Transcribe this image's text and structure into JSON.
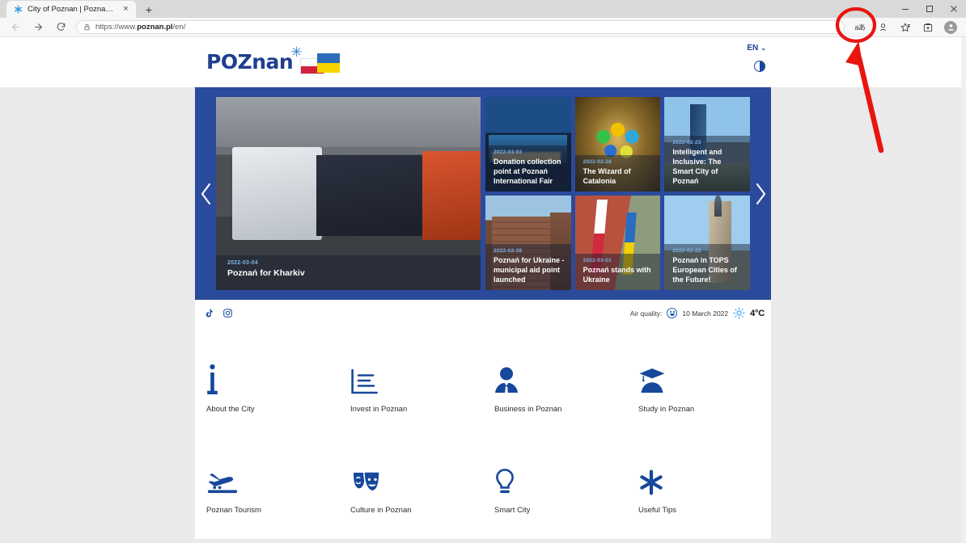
{
  "browser": {
    "tab": {
      "title": "City of Poznan | Poznan.pl",
      "favicon": "asterisk-icon",
      "close_label": "×"
    },
    "new_tab_label": "+",
    "window_controls": {
      "minimize": "—",
      "maximize": "▢",
      "close": "✕"
    },
    "nav": {
      "back_label": "←",
      "forward_label": "→",
      "reload_label": "⟳"
    },
    "omnibox": {
      "lock": "site-info-icon",
      "url_prefix": "https://www.",
      "url_domain": "poznan.pl",
      "url_path": "/en/",
      "full_url": "https://www.poznan.pl/en/"
    },
    "toolbar": {
      "read_aloud_label": "aあ",
      "collections_label": "collections-icon",
      "favorites_label": "favorites-icon",
      "browser_essentials_label": "browser-essentials-icon",
      "profile_label": "profile-icon"
    }
  },
  "annotation": {
    "highlight_target": "read-aloud-button",
    "circle_color": "#e8150f",
    "arrow_color": "#e8150f"
  },
  "site": {
    "logo": {
      "word": "POZnan",
      "star": "✳",
      "flag_pl": "Poland flag",
      "flag_ua": "Ukraine flag"
    },
    "language": {
      "current": "EN",
      "chevron": "⌄"
    },
    "contrast_toggle": "high-contrast-toggle"
  },
  "carousel": {
    "prev_label": "‹",
    "next_label": "›",
    "main_slide": {
      "date": "2022-03-04",
      "title": "Poznań for Kharkiv",
      "image": "trucks-convoy"
    },
    "tiles": [
      {
        "date": "2022-03-03",
        "title": "Donation collection point at Poznań International Fair",
        "image": "poznan-fair-night"
      },
      {
        "date": "2022-02-28",
        "title": "The Wizard of Catalonia",
        "image": "stained-glass"
      },
      {
        "date": "2022-02-23",
        "title": "Intelligent and Inclusive: The Smart City of Poznań",
        "image": "glass-tower"
      },
      {
        "date": "2022-02-28",
        "title": "Poznań for Ukraine - municipal aid point launched",
        "image": "brick-building"
      },
      {
        "date": "2022-03-01",
        "title": "Poznań stands with Ukraine",
        "image": "flags-building"
      },
      {
        "date": "2022-02-22",
        "title": "Poznań in TOPS European Cities of the Future!",
        "image": "town-hall"
      }
    ]
  },
  "infobar": {
    "social": [
      {
        "name": "tiktok-icon",
        "label": "TikTok"
      },
      {
        "name": "instagram-icon",
        "label": "Instagram"
      }
    ],
    "air_quality_label": "Air quality:",
    "air_quality_face": "smiley-good",
    "date": "10 March 2022",
    "weather_icon": "sun-icon",
    "temperature": "4°C"
  },
  "shortcuts": {
    "row1": [
      {
        "icon": "info-icon",
        "label": "About the City"
      },
      {
        "icon": "bar-chart-icon",
        "label": "Invest in Poznan"
      },
      {
        "icon": "businessperson-icon",
        "label": "Business in Poznan"
      },
      {
        "icon": "graduate-icon",
        "label": "Study in Poznan"
      }
    ],
    "row2": [
      {
        "icon": "plane-landing-icon",
        "label": "Poznan Tourism"
      },
      {
        "icon": "theater-masks-icon",
        "label": "Culture in Poznan"
      },
      {
        "icon": "lightbulb-icon",
        "label": "Smart City"
      },
      {
        "icon": "asterisk-icon",
        "label": "Useful Tips"
      }
    ]
  },
  "colors": {
    "brand_blue": "#16489b",
    "carousel_blue": "#2a4a9c",
    "page_grey": "#eaeaea",
    "annotation_red": "#e8150f"
  }
}
